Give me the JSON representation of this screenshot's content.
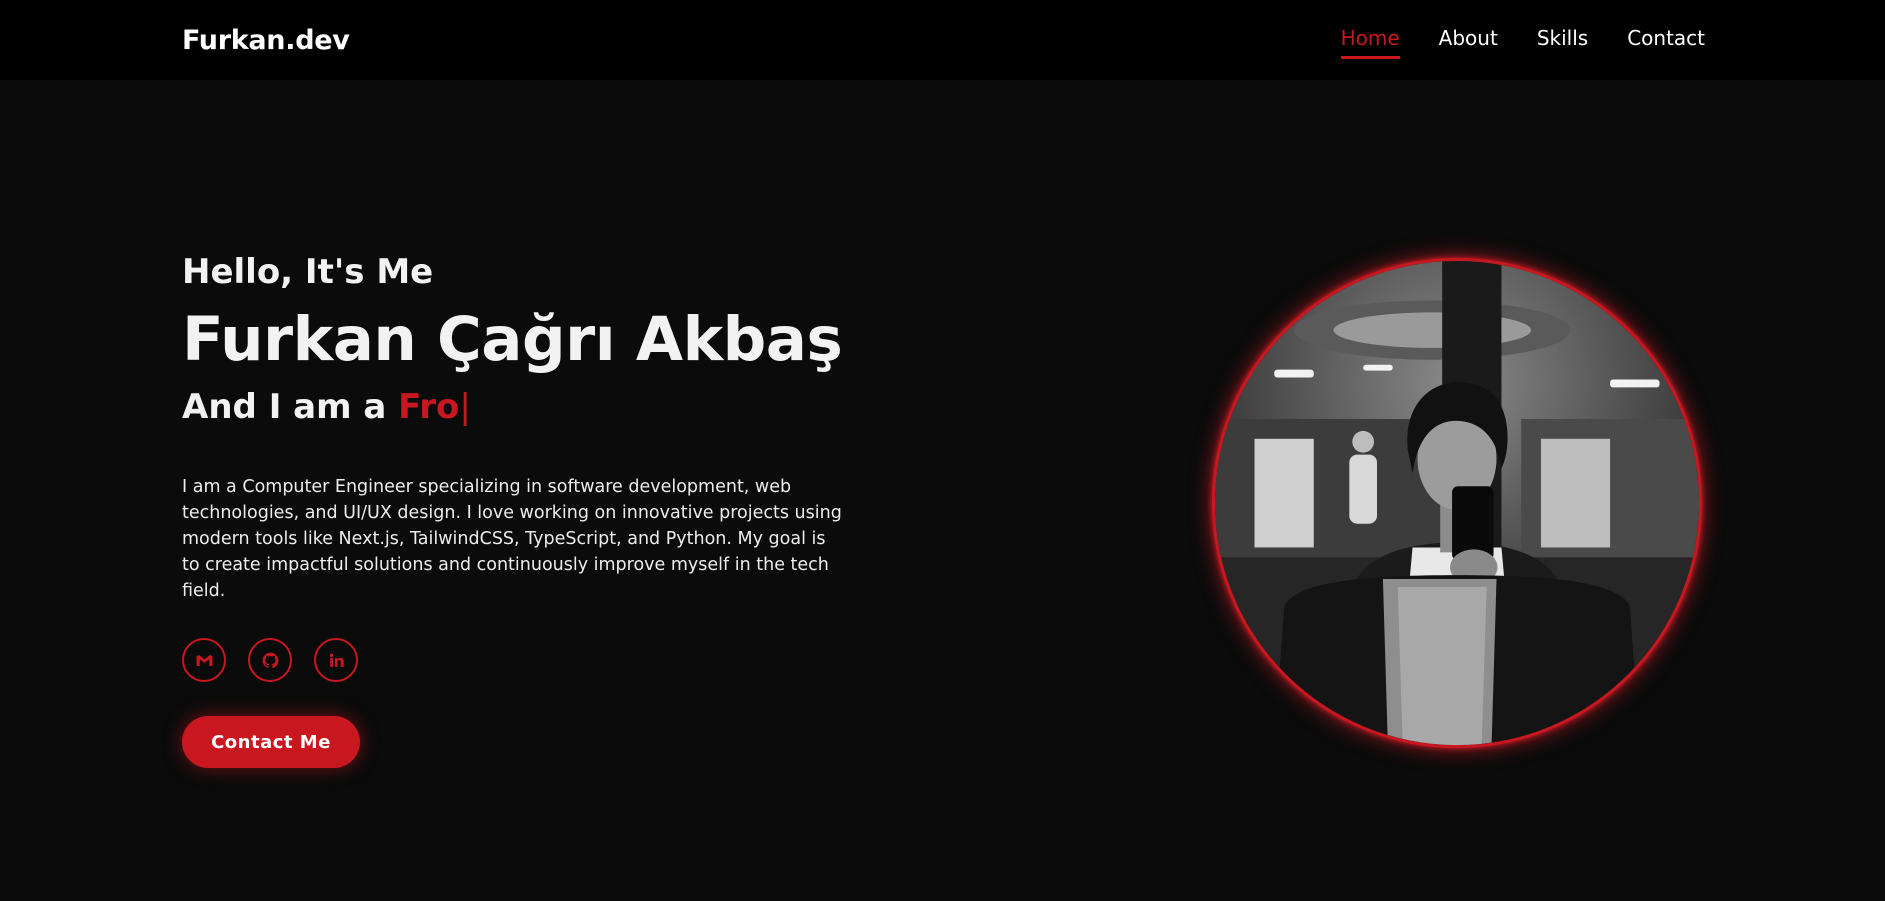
{
  "header": {
    "logo": "Furkan.dev",
    "nav": [
      {
        "label": "Home",
        "active": true
      },
      {
        "label": "About",
        "active": false
      },
      {
        "label": "Skills",
        "active": false
      },
      {
        "label": "Contact",
        "active": false
      }
    ]
  },
  "hero": {
    "greeting": "Hello, It's Me",
    "name": "Furkan Çağrı Akbaş",
    "role_prefix": "And I am a ",
    "role_typed": "Fro",
    "cursor": "|",
    "bio": "I am a Computer Engineer specializing in software development, web technologies, and UI/UX design. I love working on innovative projects using modern tools like Next.js, TailwindCSS, TypeScript, and Python. My goal is to create impactful solutions and continuously improve myself in the tech field.",
    "socials": [
      {
        "icon": "gmail-icon"
      },
      {
        "icon": "github-icon"
      },
      {
        "icon": "linkedin-icon"
      }
    ],
    "cta_label": "Contact Me",
    "portrait": "profile-photo"
  },
  "colors": {
    "accent": "#c8171e",
    "background": "#0b0b0b",
    "header_background": "#000000",
    "text": "#ffffff"
  }
}
